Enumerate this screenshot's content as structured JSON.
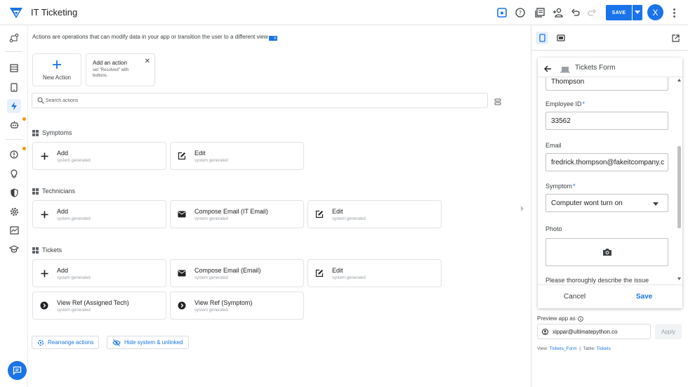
{
  "app": {
    "title": "IT Ticketing"
  },
  "topbar": {
    "icons": [
      "preview-icon",
      "help-icon",
      "library-icon",
      "add-person-icon",
      "undo-icon",
      "redo-icon"
    ],
    "save_label": "SAVE",
    "avatar_initial": "X"
  },
  "leftrail": {
    "items": [
      "data-icon",
      "views-icon",
      "actions-icon",
      "automation-icon",
      "errors-icon",
      "ideas-icon",
      "security-icon",
      "settings-icon",
      "monitor-icon",
      "learn-icon"
    ],
    "active": "actions-icon"
  },
  "main": {
    "intro": "Actions are operations that can modify data in your app or transition the user to a different view",
    "new_action_label": "New Action",
    "tip": {
      "title": "Add an action",
      "body": "set \"Resolved\" with buttons."
    },
    "search_placeholder": "Search actions",
    "sections": [
      {
        "title": "Symptoms",
        "cards": [
          {
            "icon": "plus-icon",
            "title": "Add",
            "sub": "system generated"
          },
          {
            "icon": "edit-icon",
            "title": "Edit",
            "sub": "system generated"
          }
        ]
      },
      {
        "title": "Technicians",
        "cards": [
          {
            "icon": "plus-icon",
            "title": "Add",
            "sub": "system generated"
          },
          {
            "icon": "email-icon",
            "title": "Compose Email (IT Email)",
            "sub": "system generated"
          },
          {
            "icon": "edit-icon",
            "title": "Edit",
            "sub": "system generated"
          }
        ]
      },
      {
        "title": "Tickets",
        "cards": [
          {
            "icon": "plus-icon",
            "title": "Add",
            "sub": "system generated"
          },
          {
            "icon": "email-icon",
            "title": "Compose Email (Email)",
            "sub": "system generated"
          },
          {
            "icon": "edit-icon",
            "title": "Edit",
            "sub": "system generated"
          },
          {
            "icon": "arrow-circle-icon",
            "title": "View Ref (Assigned Tech)",
            "sub": "system generated"
          },
          {
            "icon": "arrow-circle-icon",
            "title": "View Ref (Symptom)",
            "sub": "system generated"
          }
        ]
      }
    ],
    "rearrange_label": "Rearrange actions",
    "hide_label": "Hide system & unlinked"
  },
  "preview": {
    "form_title": "Tickets Form",
    "fields": {
      "last_name_value": "Thompson",
      "employee_id_label": "Employee ID",
      "employee_id_value": "33562",
      "email_label": "Email",
      "email_value": "fredrick.thompson@fakeitcompany.c",
      "symptom_label": "Symptom",
      "symptom_value": "Computer wont turn on",
      "photo_label": "Photo",
      "describe_label": "Please thoroughly describe the issue"
    },
    "required_mark": "*",
    "cancel_label": "Cancel",
    "save_label": "Save",
    "preview_as_label": "Preview app as",
    "preview_as_value": "xippar@ultimatepython.co",
    "apply_label": "Apply",
    "view_prefix": "View:",
    "view_name": "Tickets_Form",
    "separator": "|",
    "table_prefix": "Table:",
    "table_name": "Tickets"
  },
  "colors": {
    "accent": "#1a73e8",
    "warning_dot": "#f29900"
  }
}
